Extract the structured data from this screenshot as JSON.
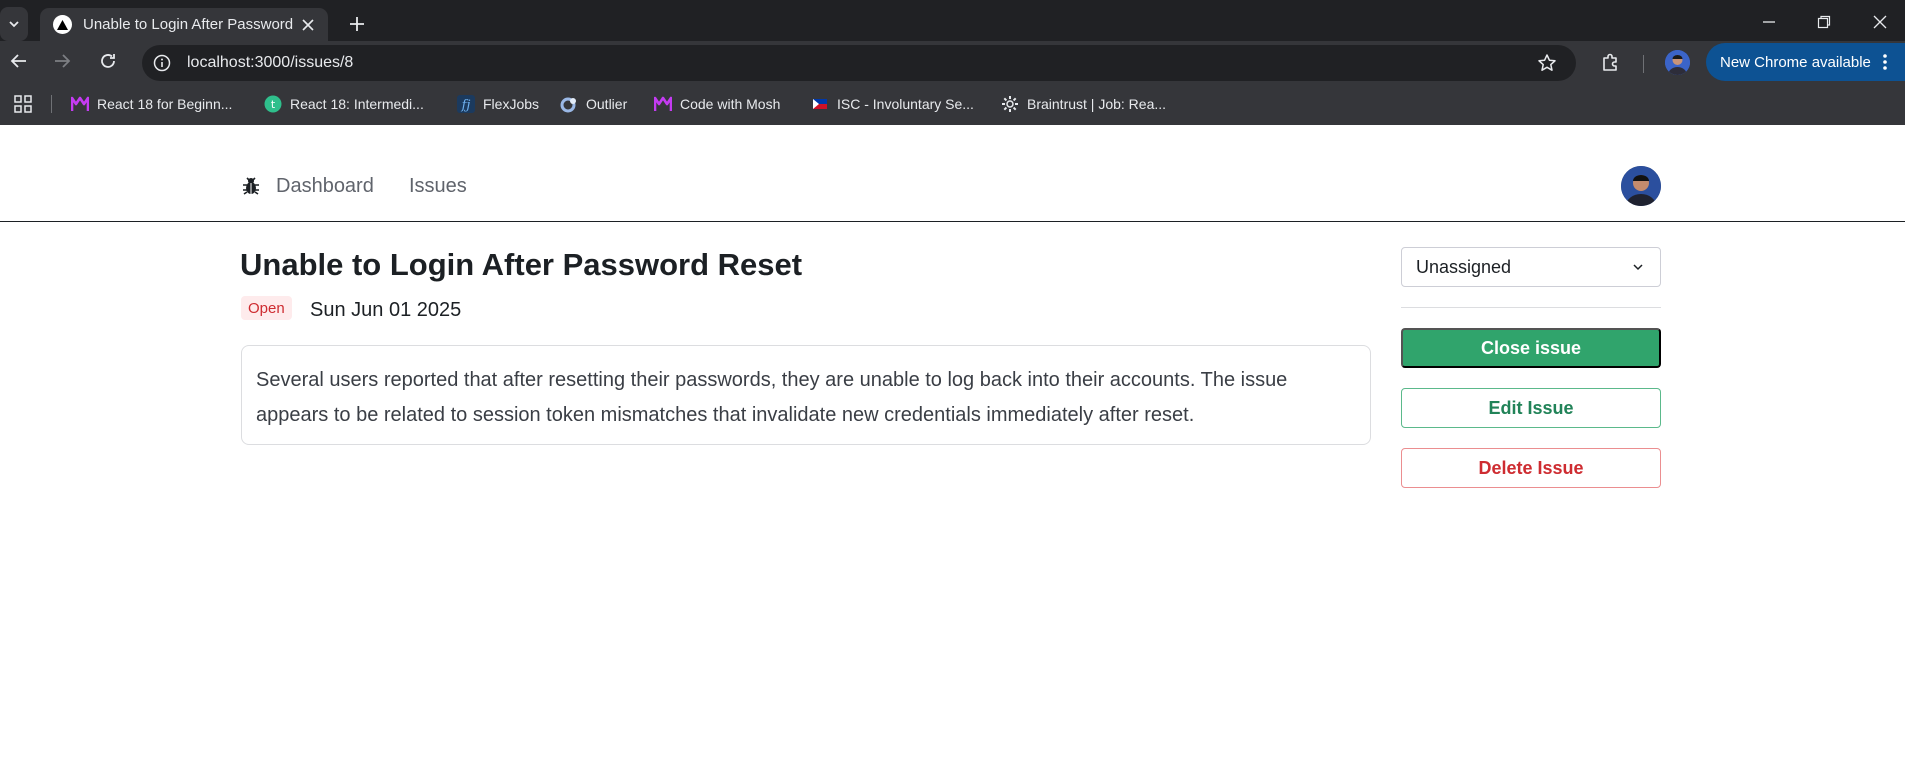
{
  "browser": {
    "tab": {
      "title": "Unable to Login After Password Reset"
    },
    "address_bar": {
      "url": "localhost:3000/issues/8"
    },
    "update_button": {
      "label": "New Chrome available"
    },
    "bookmarks": [
      {
        "label": "React 18 for Beginn...",
        "icon": "mosh-logo-icon",
        "color": "#c43bf2"
      },
      {
        "label": "React 18: Intermedi...",
        "icon": "teachable-logo-icon",
        "color": "#2fbf8c"
      },
      {
        "label": "FlexJobs",
        "icon": "flexjobs-logo-icon",
        "color": "#4a90d9"
      },
      {
        "label": "Outlier",
        "icon": "outlier-logo-icon",
        "color": "#9ab8e6"
      },
      {
        "label": "Code with Mosh",
        "icon": "mosh-logo-icon",
        "color": "#c43bf2"
      },
      {
        "label": "ISC - Involuntary Se...",
        "icon": "flag-icon",
        "color": "#d9322b"
      },
      {
        "label": "Braintrust | Job: Rea...",
        "icon": "gear-icon",
        "color": "#e8eaed"
      }
    ]
  },
  "app_nav": {
    "links": [
      {
        "label": "Dashboard"
      },
      {
        "label": "Issues"
      }
    ]
  },
  "issue": {
    "title": "Unable to Login After Password Reset",
    "status": "Open",
    "date": "Sun Jun 01 2025",
    "description": "Several users reported that after resetting their passwords, they are unable to log back into their accounts. The issue appears to be related to session token mismatches that invalidate new credentials immediately after reset."
  },
  "sidebar": {
    "assignee": {
      "value": "Unassigned"
    },
    "close_label": "Close issue",
    "edit_label": "Edit Issue",
    "delete_label": "Delete Issue"
  },
  "colors": {
    "accent_green": "#30a46c",
    "danger_red": "#ce2c31",
    "badge_bg": "#feebec"
  }
}
